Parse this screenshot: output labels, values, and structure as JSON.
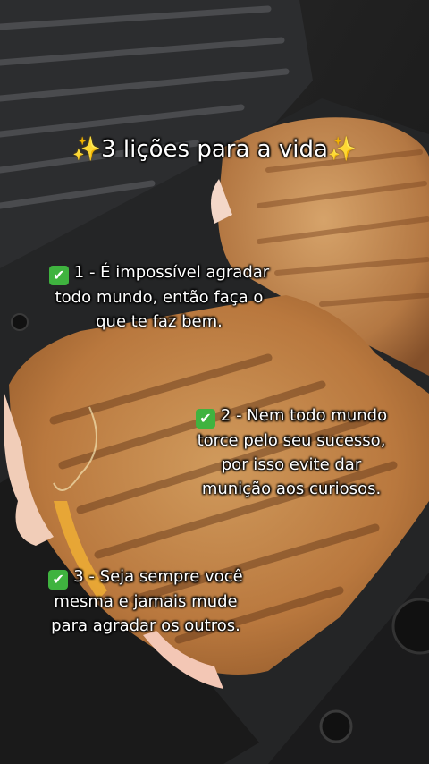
{
  "title": {
    "sparkle_left": "✨",
    "text": "3 lições para a vida",
    "sparkle_right": "✨"
  },
  "lessons": [
    {
      "check": "✔",
      "lines": [
        "1 - É impossível agradar",
        "todo mundo, então faça o",
        "que te faz bem."
      ]
    },
    {
      "check": "✔",
      "lines": [
        "2 - Nem todo mundo",
        "torce pelo seu sucesso,",
        "por isso evite dar",
        "munição aos curiosos."
      ]
    },
    {
      "check": "✔",
      "lines": [
        "3 - Seja sempre você",
        "mesma e jamais mude",
        "para agradar os outros."
      ]
    }
  ],
  "colors": {
    "check_green": "#3fb33f",
    "toast": "#c8894a",
    "grill": "#1e1e1e"
  }
}
